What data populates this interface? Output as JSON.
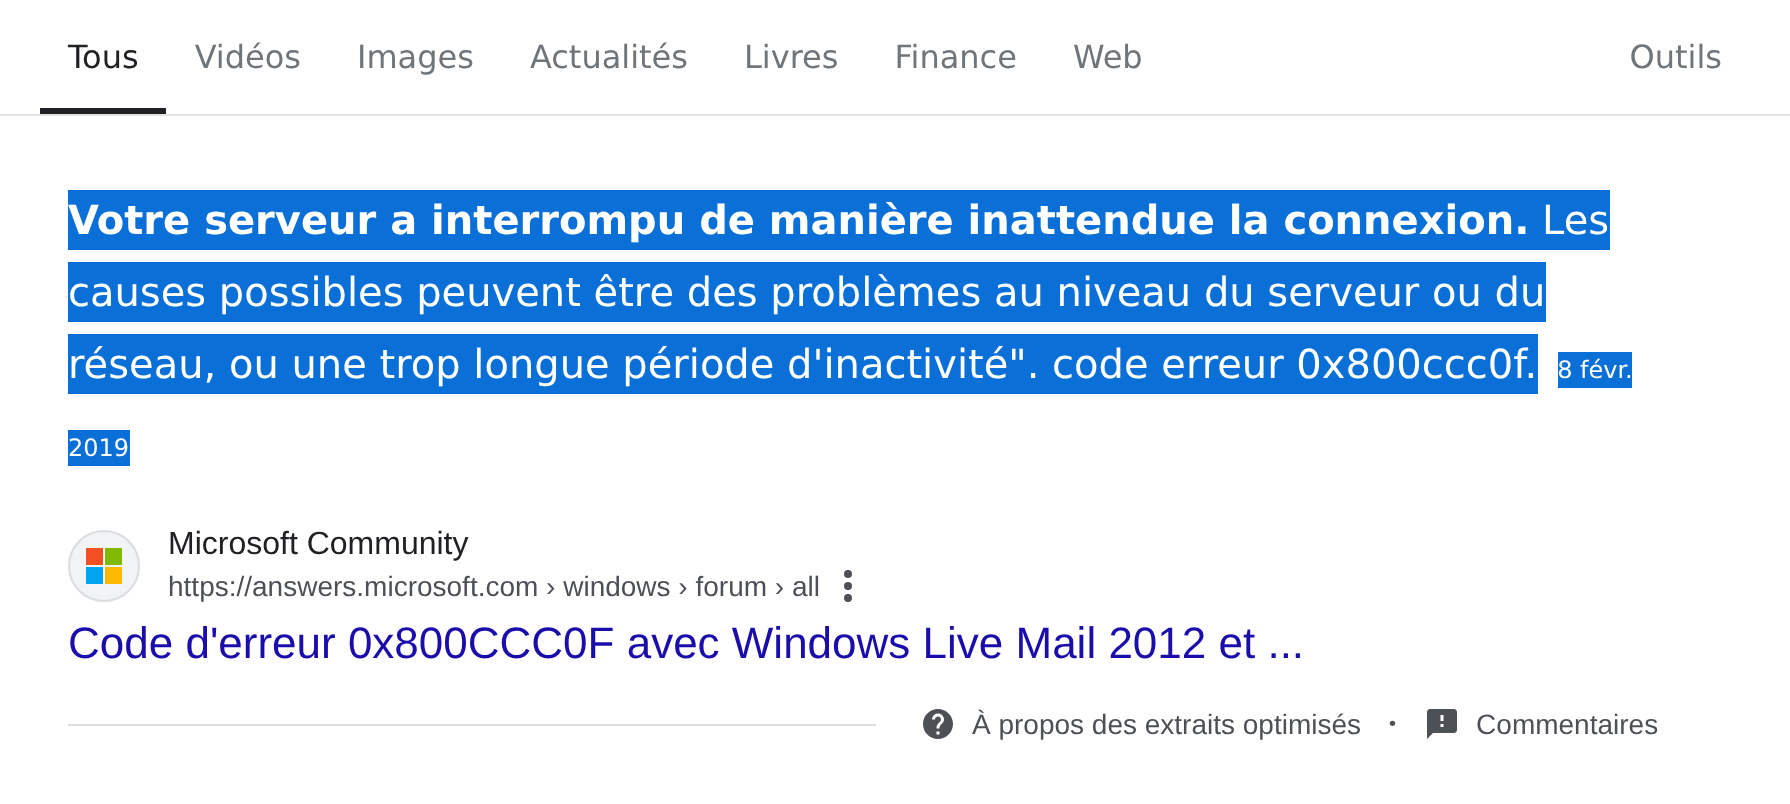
{
  "tabs": [
    {
      "label": "Tous",
      "selected": true
    },
    {
      "label": "Vidéos",
      "selected": false
    },
    {
      "label": "Images",
      "selected": false
    },
    {
      "label": "Actualités",
      "selected": false
    },
    {
      "label": "Livres",
      "selected": false
    },
    {
      "label": "Finance",
      "selected": false
    },
    {
      "label": "Web",
      "selected": false
    }
  ],
  "tools": "Outils",
  "snippet": {
    "text": "**Votre serveur a interrompu de manière inattendue la connexion.** Les causes possibles peuvent être des problèmes au niveau du serveur ou du réseau, ou une trop longue période d'inactivité\". code erreur 0x800ccc0f.",
    "date": "8 févr. 2019",
    "selected": true
  },
  "source": {
    "name": "Microsoft Community",
    "url": "https://answers.microsoft.com › windows › forum › all"
  },
  "result_title": "Code d'erreur 0x800CCC0F avec Windows Live Mail 2012 et ...",
  "footer": {
    "about": "À propos des extraits optimisés",
    "separator": "•",
    "feedback": "Commentaires"
  }
}
